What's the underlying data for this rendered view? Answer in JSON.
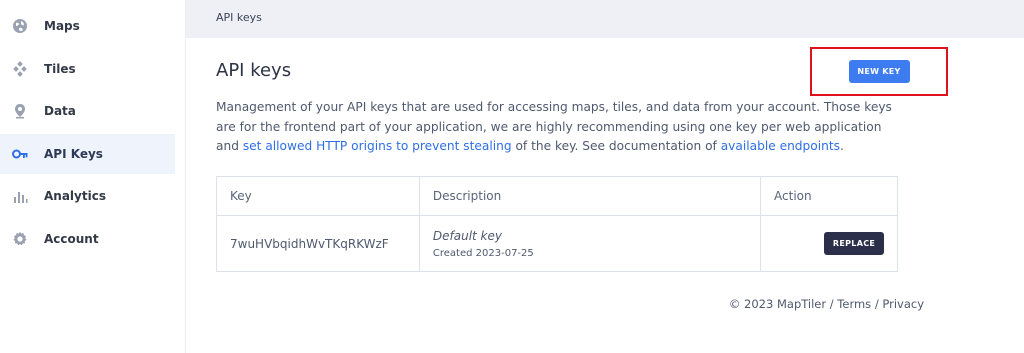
{
  "sidebar": {
    "items": [
      {
        "label": "Maps",
        "icon": "globe-icon",
        "active": false
      },
      {
        "label": "Tiles",
        "icon": "tiles-icon",
        "active": false
      },
      {
        "label": "Data",
        "icon": "location-pin-icon",
        "active": false
      },
      {
        "label": "API Keys",
        "icon": "key-icon",
        "active": true
      },
      {
        "label": "Analytics",
        "icon": "bar-chart-icon",
        "active": false
      },
      {
        "label": "Account",
        "icon": "gear-icon",
        "active": false
      }
    ]
  },
  "breadcrumb": "API keys",
  "page": {
    "title": "API keys",
    "new_key_label": "NEW KEY",
    "description": {
      "part1": "Management of your API keys that are used for accessing maps, tiles, and data from your account. Those keys are for the frontend part of your application, we are highly recommending using one key per web application and ",
      "link1": "set allowed HTTP origins to prevent stealing",
      "part2": " of the key. See documentation of ",
      "link2": "available endpoints",
      "part3": "."
    }
  },
  "table": {
    "headers": {
      "key": "Key",
      "description": "Description",
      "action": "Action"
    },
    "rows": [
      {
        "key": "7wuHVbqidhWvTKqRKWzF",
        "description_name": "Default key",
        "created": "Created 2023-07-25",
        "action_label": "REPLACE"
      }
    ]
  },
  "footer": {
    "copyright": "© 2023 MapTiler",
    "sep1": " / ",
    "terms": "Terms",
    "sep2": " / ",
    "privacy": "Privacy"
  },
  "colors": {
    "accent": "#3d7cf0",
    "highlight_box": "#e0101c",
    "replace_button": "#2b2f4a",
    "sidebar_active_bg": "#eef3fc"
  }
}
